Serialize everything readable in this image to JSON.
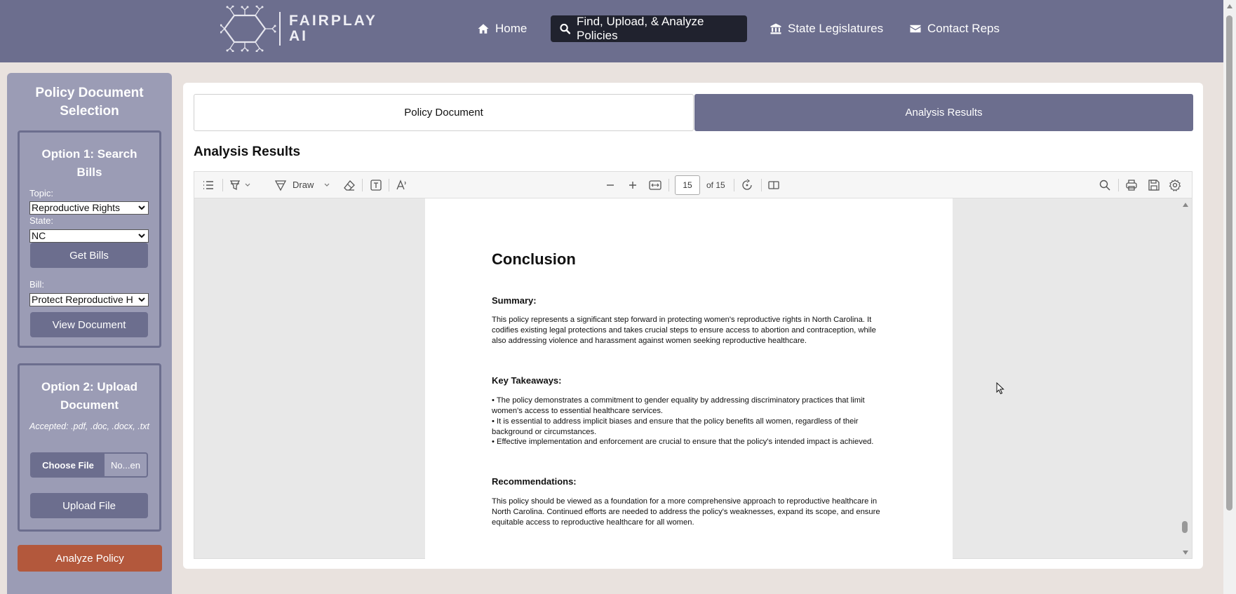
{
  "header": {
    "logo_line1": "FAIRPLAY",
    "logo_line2": "AI",
    "nav": [
      {
        "label": "Home",
        "icon": "home-icon"
      },
      {
        "label": "Find, Upload, & Analyze Policies",
        "icon": "search-icon",
        "active": true
      },
      {
        "label": "State Legislatures",
        "icon": "landmark-icon"
      },
      {
        "label": "Contact Reps",
        "icon": "envelope-icon"
      }
    ]
  },
  "sidebar": {
    "title": "Policy Document Selection",
    "option1": {
      "title": "Option 1: Search Bills",
      "topic_label": "Topic:",
      "topic_value": "Reproductive Rights",
      "state_label": "State:",
      "state_value": "NC",
      "get_bills_label": "Get Bills",
      "bill_label": "Bill:",
      "bill_value": "Protect Reproductive H",
      "view_document_label": "View Document"
    },
    "option2": {
      "title": "Option 2: Upload Document",
      "accepted": "Accepted: .pdf, .doc, .docx, .txt",
      "choose_file_label": "Choose File",
      "file_status": "No...en",
      "upload_label": "Upload File"
    },
    "analyze_label": "Analyze Policy"
  },
  "main": {
    "tabs": [
      {
        "label": "Policy Document",
        "active": false
      },
      {
        "label": "Analysis Results",
        "active": true
      }
    ],
    "section_title": "Analysis Results"
  },
  "viewer": {
    "toolbar": {
      "draw_label": "Draw",
      "page_current": "15",
      "page_total": "of 15"
    },
    "page": {
      "heading": "Conclusion",
      "summary_heading": "Summary:",
      "summary_text": "This policy represents a significant step forward in protecting women's reproductive rights in North Carolina. It codifies existing legal protections and takes crucial steps to ensure access to abortion and contraception, while also addressing violence and harassment against women seeking reproductive healthcare.",
      "takeaways_heading": "Key Takeaways:",
      "takeaways": [
        "• The policy demonstrates a commitment to gender equality by addressing discriminatory practices that limit women's access to essential healthcare services.",
        "• It is essential to address implicit biases and ensure that the policy benefits all women, regardless of their background or circumstances.",
        "• Effective implementation and enforcement are crucial to ensure that the policy's intended impact is achieved."
      ],
      "recommendations_heading": "Recommendations:",
      "recommendations_text": "This policy should be viewed as a foundation for a more comprehensive approach to reproductive healthcare in North Carolina. Continued efforts are needed to address the policy's weaknesses, expand its scope, and ensure equitable access to reproductive healthcare for all women."
    }
  },
  "colors": {
    "nav_bg": "#6c6e8e",
    "active_nav_bg": "#20222e",
    "sidebar_bg": "#9b9cb5",
    "analyze_bg": "#b3583c",
    "page_bg": "#e9e2de"
  }
}
